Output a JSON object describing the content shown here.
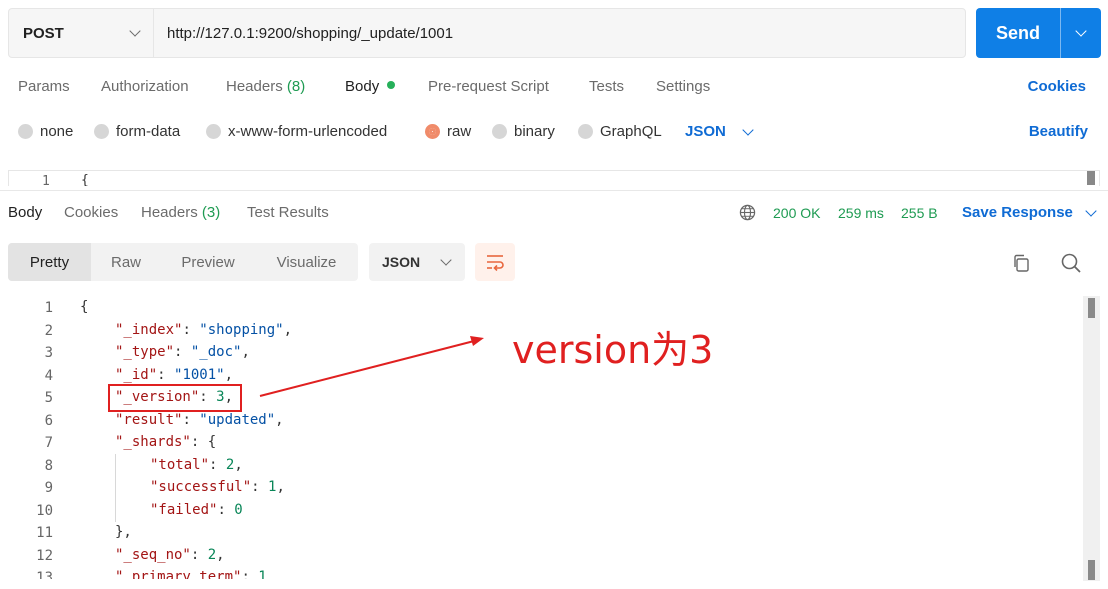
{
  "request": {
    "method": "POST",
    "url": "http://127.0.1:9200/shopping/_update/1001",
    "send_label": "Send"
  },
  "request_tabs": {
    "params": "Params",
    "authorization": "Authorization",
    "headers": "Headers",
    "headers_count": "(8)",
    "body": "Body",
    "pre_request": "Pre-request Script",
    "tests": "Tests",
    "settings": "Settings",
    "cookies": "Cookies"
  },
  "body_types": {
    "none": "none",
    "form_data": "form-data",
    "urlencoded": "x-www-form-urlencoded",
    "raw": "raw",
    "binary": "binary",
    "graphql": "GraphQL",
    "format": "JSON",
    "beautify": "Beautify",
    "selected": "raw"
  },
  "request_editor": {
    "line_number": "1",
    "first_char": "{"
  },
  "response_tabs": {
    "body": "Body",
    "cookies": "Cookies",
    "headers": "Headers",
    "headers_count": "(3)",
    "test_results": "Test Results"
  },
  "response_meta": {
    "status": "200 OK",
    "time": "259 ms",
    "size": "255 B",
    "save_response": "Save Response"
  },
  "view": {
    "pretty": "Pretty",
    "raw": "Raw",
    "preview": "Preview",
    "visualize": "Visualize",
    "format": "JSON"
  },
  "code_lines": [
    {
      "n": "1",
      "indent": 0,
      "parts": [
        {
          "t": "{",
          "c": "punc"
        }
      ]
    },
    {
      "n": "2",
      "indent": 1,
      "parts": [
        {
          "t": "\"_index\"",
          "c": "key"
        },
        {
          "t": ": ",
          "c": "punc"
        },
        {
          "t": "\"shopping\"",
          "c": "str"
        },
        {
          "t": ",",
          "c": "punc"
        }
      ]
    },
    {
      "n": "3",
      "indent": 1,
      "parts": [
        {
          "t": "\"_type\"",
          "c": "key"
        },
        {
          "t": ": ",
          "c": "punc"
        },
        {
          "t": "\"_doc\"",
          "c": "str"
        },
        {
          "t": ",",
          "c": "punc"
        }
      ]
    },
    {
      "n": "4",
      "indent": 1,
      "parts": [
        {
          "t": "\"_id\"",
          "c": "key"
        },
        {
          "t": ": ",
          "c": "punc"
        },
        {
          "t": "\"1001\"",
          "c": "str"
        },
        {
          "t": ",",
          "c": "punc"
        }
      ]
    },
    {
      "n": "5",
      "indent": 1,
      "parts": [
        {
          "t": "\"_version\"",
          "c": "key"
        },
        {
          "t": ": ",
          "c": "punc"
        },
        {
          "t": "3",
          "c": "num"
        },
        {
          "t": ",",
          "c": "punc"
        }
      ]
    },
    {
      "n": "6",
      "indent": 1,
      "parts": [
        {
          "t": "\"result\"",
          "c": "key"
        },
        {
          "t": ": ",
          "c": "punc"
        },
        {
          "t": "\"updated\"",
          "c": "str"
        },
        {
          "t": ",",
          "c": "punc"
        }
      ]
    },
    {
      "n": "7",
      "indent": 1,
      "parts": [
        {
          "t": "\"_shards\"",
          "c": "key"
        },
        {
          "t": ": {",
          "c": "punc"
        }
      ]
    },
    {
      "n": "8",
      "indent": 2,
      "parts": [
        {
          "t": "\"total\"",
          "c": "key"
        },
        {
          "t": ": ",
          "c": "punc"
        },
        {
          "t": "2",
          "c": "num"
        },
        {
          "t": ",",
          "c": "punc"
        }
      ]
    },
    {
      "n": "9",
      "indent": 2,
      "parts": [
        {
          "t": "\"successful\"",
          "c": "key"
        },
        {
          "t": ": ",
          "c": "punc"
        },
        {
          "t": "1",
          "c": "num"
        },
        {
          "t": ",",
          "c": "punc"
        }
      ]
    },
    {
      "n": "10",
      "indent": 2,
      "parts": [
        {
          "t": "\"failed\"",
          "c": "key"
        },
        {
          "t": ": ",
          "c": "punc"
        },
        {
          "t": "0",
          "c": "num"
        }
      ]
    },
    {
      "n": "11",
      "indent": 1,
      "parts": [
        {
          "t": "},",
          "c": "punc"
        }
      ]
    },
    {
      "n": "12",
      "indent": 1,
      "parts": [
        {
          "t": "\"_seq_no\"",
          "c": "key"
        },
        {
          "t": ": ",
          "c": "punc"
        },
        {
          "t": "2",
          "c": "num"
        },
        {
          "t": ",",
          "c": "punc"
        }
      ]
    },
    {
      "n": "13",
      "indent": 1,
      "parts": [
        {
          "t": "\"_primary_term\"",
          "c": "key"
        },
        {
          "t": ": ",
          "c": "punc"
        },
        {
          "t": "1",
          "c": "num"
        }
      ]
    }
  ],
  "annotation": {
    "text": "version为3",
    "color": "#e02020"
  },
  "colors": {
    "accent": "#0f7fe6",
    "link": "#0f6bd4",
    "success": "#1e9b52",
    "radio_selected": "#f08b6a"
  }
}
